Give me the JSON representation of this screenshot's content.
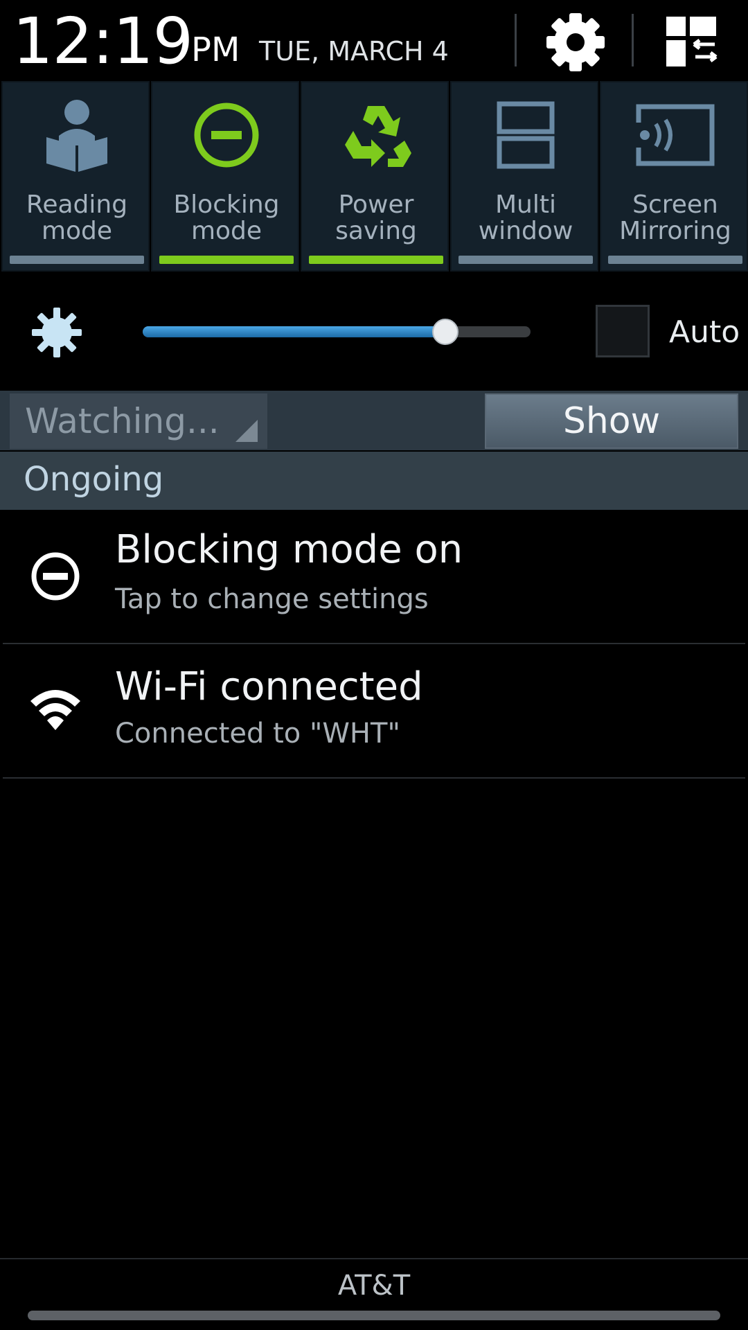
{
  "status": {
    "time": "12:19",
    "ampm": "PM",
    "date": "TUE, MARCH 4"
  },
  "header_icons": {
    "settings": "gear-icon",
    "multi": "quick-settings-grid-icon"
  },
  "toggles": [
    {
      "label": "Reading\nmode",
      "icon": "reading-person-icon",
      "on": false
    },
    {
      "label": "Blocking\nmode",
      "icon": "blocking-minus-circle-icon",
      "on": true
    },
    {
      "label": "Power\nsaving",
      "icon": "recycle-icon",
      "on": true
    },
    {
      "label": "Multi\nwindow",
      "icon": "multi-window-icon",
      "on": false
    },
    {
      "label": "Screen\nMirroring",
      "icon": "screen-mirroring-icon",
      "on": false
    }
  ],
  "brightness": {
    "level": 0.78,
    "auto_label": "Auto",
    "auto_checked": false
  },
  "watch": {
    "dropdown_text": "Watching...",
    "show_label": "Show"
  },
  "ongoing_label": "Ongoing",
  "notifications": [
    {
      "title": "Blocking mode on",
      "subtitle": "Tap to change settings",
      "icon": "blocking-minus-circle-icon"
    },
    {
      "title": "Wi-Fi connected",
      "subtitle": "Connected to \"WHT\"",
      "icon": "wifi-icon"
    }
  ],
  "carrier": "AT&T",
  "colors": {
    "accent_green": "#7ecb1d",
    "toggle_off_bar": "#6c8293",
    "slider_blue": "#2a88cc"
  }
}
